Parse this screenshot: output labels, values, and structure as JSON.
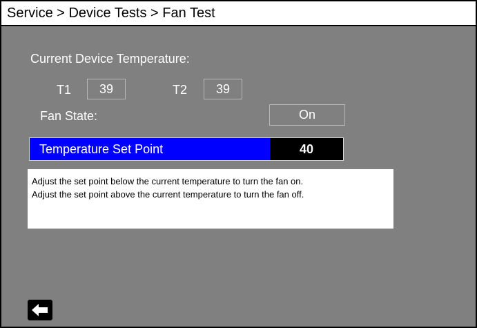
{
  "breadcrumb": "Service > Device Tests > Fan Test",
  "temperature": {
    "heading": "Current Device Temperature:",
    "t1_label": "T1",
    "t1_value": "39",
    "t2_label": "T2",
    "t2_value": "39"
  },
  "fan": {
    "label": "Fan State:",
    "value": "On"
  },
  "setpoint": {
    "label": "Temperature Set Point",
    "value": "40"
  },
  "instructions": {
    "line1": "Adjust the set point below the current temperature to turn the fan on.",
    "line2": "Adjust the set point above the current temperature to turn the fan off."
  },
  "back_button": {
    "icon": "back-arrow-icon"
  },
  "colors": {
    "background": "#808080",
    "header": "#ffffff",
    "selection": "#0000ff",
    "value_highlight": "#000000"
  }
}
